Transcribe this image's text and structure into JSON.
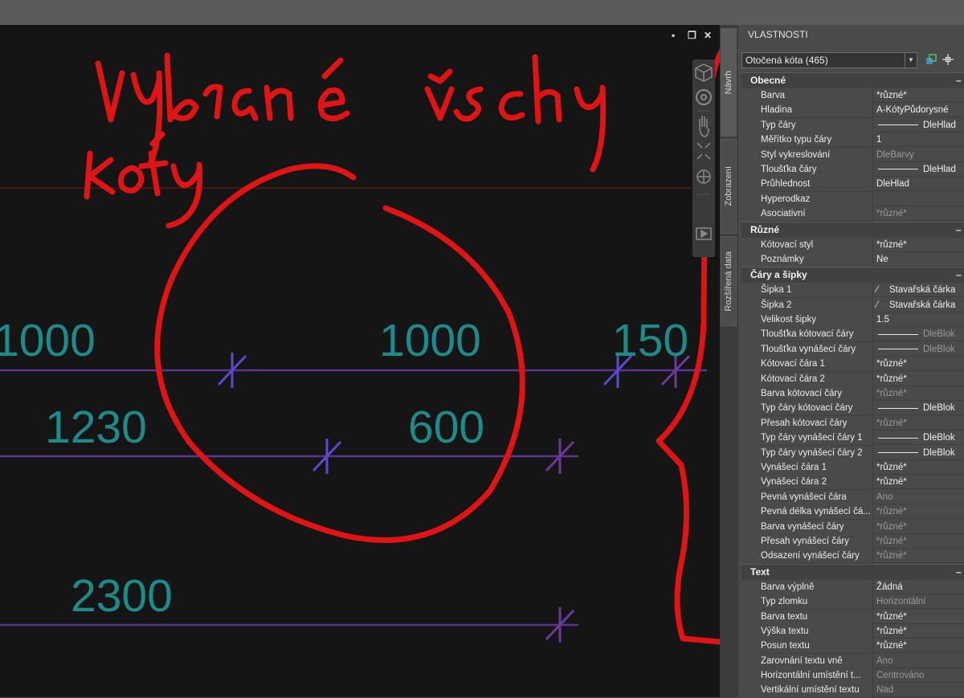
{
  "colors": {
    "viewport_bg": "#151515",
    "dimension_text": "#1e8a8a",
    "dimension_line": "#3f3fb0",
    "annotation": "#e01010",
    "panel_bg": "#4a4a4a"
  },
  "viewport": {
    "window_buttons": [
      "▪",
      "❐",
      "✕"
    ],
    "navigation_bar_icons": [
      "view-cube-icon",
      "steering-wheel-icon",
      "pan-icon",
      "zoom-extents-icon",
      "orbit-icon",
      "showmotion-icon"
    ]
  },
  "drawing": {
    "dimensions": [
      {
        "id": "1000a",
        "text": "1000"
      },
      {
        "id": "1000b",
        "text": "1000"
      },
      {
        "id": "150",
        "text": "150"
      },
      {
        "id": "1230",
        "text": "1230"
      },
      {
        "id": "600",
        "text": "600"
      },
      {
        "id": "2300",
        "text": "2300"
      }
    ],
    "handwritten_note": "Vybrané všechny kóty"
  },
  "side_tabs": [
    "Návrh",
    "Zobrazení",
    "Rozšířená data"
  ],
  "panel": {
    "title": "VLASTNOSTI",
    "selection": "Otočená kóta (465)",
    "sections": [
      {
        "title": "Obecné",
        "rows": [
          {
            "label": "Barva",
            "value": "*různé*"
          },
          {
            "label": "Hladina",
            "value": "A-KótyPůdorysné"
          },
          {
            "label": "Typ čáry",
            "value": "DleHlad",
            "line": true
          },
          {
            "label": "Měřítko typu čáry",
            "value": "1"
          },
          {
            "label": "Styl vykreslování",
            "value": "DleBarvy",
            "disabled": true
          },
          {
            "label": "Tloušťka čáry",
            "value": "DleHlad",
            "line": true
          },
          {
            "label": "Průhlednost",
            "value": "DleHlad"
          },
          {
            "label": "Hyperodkaz",
            "value": ""
          },
          {
            "label": "Asociativní",
            "value": "*různé*",
            "disabled": true
          }
        ]
      },
      {
        "title": "Různé",
        "rows": [
          {
            "label": "Kótovací styl",
            "value": "*různé*"
          },
          {
            "label": "Poznámky",
            "value": "Ne"
          }
        ]
      },
      {
        "title": "Čáry a šipky",
        "rows": [
          {
            "label": "Šipka 1",
            "value": "Stavařská čárka",
            "arrow": true
          },
          {
            "label": "Šipka 2",
            "value": "Stavařská čárka",
            "arrow": true
          },
          {
            "label": "Velikost šipky",
            "value": "1.5"
          },
          {
            "label": "Tloušťka kótovací čáry",
            "value": "DleBlok",
            "line": true,
            "disabled": true
          },
          {
            "label": "Tloušťka vynášecí čáry",
            "value": "DleBlok",
            "line": true,
            "disabled": true
          },
          {
            "label": "Kótovací čára 1",
            "value": "*různé*"
          },
          {
            "label": "Kótovací čára 2",
            "value": "*různé*"
          },
          {
            "label": "Barva kótovací čáry",
            "value": "*různé*",
            "disabled": true
          },
          {
            "label": "Typ čáry kótovací čáry",
            "value": "DleBlok",
            "line": true
          },
          {
            "label": "Přesah kótovací čáry",
            "value": "*různé*",
            "disabled": true
          },
          {
            "label": "Typ čáry vynášecí čáry 1",
            "value": "DleBlok",
            "line": true
          },
          {
            "label": "Typ čáry vynášecí čáry 2",
            "value": "DleBlok",
            "line": true
          },
          {
            "label": "Vynášecí čára 1",
            "value": "*různé*"
          },
          {
            "label": "Vynášecí čára 2",
            "value": "*různé*"
          },
          {
            "label": "Pevná vynášecí čára",
            "value": "Ano",
            "disabled": true
          },
          {
            "label": "Pevná délka vynášecí čá...",
            "value": "*různé*",
            "disabled": true
          },
          {
            "label": "Barva vynášecí čáry",
            "value": "*různé*",
            "disabled": true
          },
          {
            "label": "Přesah vynášecí čáry",
            "value": "*různé*",
            "disabled": true
          },
          {
            "label": "Odsazení vynášecí čáry",
            "value": "*různé*",
            "disabled": true
          }
        ]
      },
      {
        "title": "Text",
        "rows": [
          {
            "label": "Barva výplně",
            "value": "Žádná"
          },
          {
            "label": "Typ zlomku",
            "value": "Horizontální",
            "disabled": true
          },
          {
            "label": "Barva textu",
            "value": "*různé*"
          },
          {
            "label": "Výška textu",
            "value": "*různé*"
          },
          {
            "label": "Posun textu",
            "value": "*různé*"
          },
          {
            "label": "Zarovnání textu vně",
            "value": "Ano",
            "disabled": true
          },
          {
            "label": "Horizontální umístění t...",
            "value": "Centrováno",
            "disabled": true
          },
          {
            "label": "Vertikální umístění textu",
            "value": "Nad",
            "disabled": true
          }
        ]
      }
    ]
  }
}
